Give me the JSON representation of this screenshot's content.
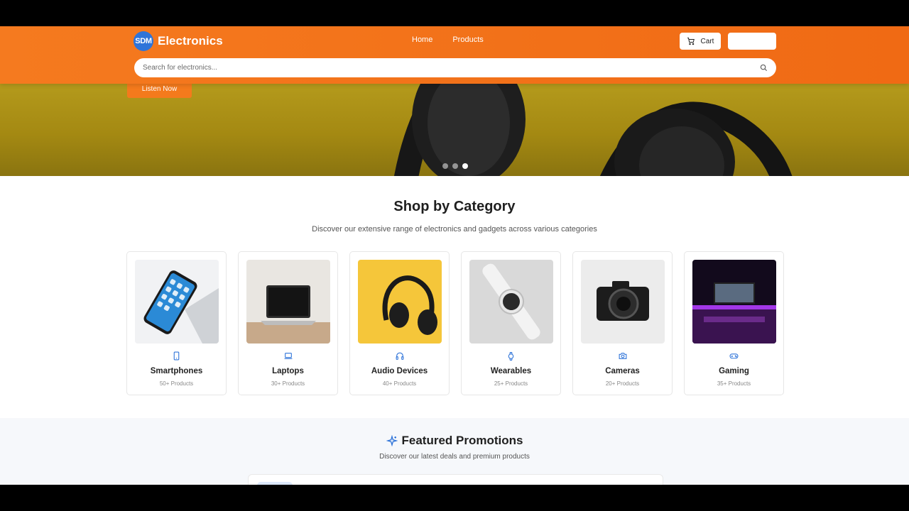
{
  "header": {
    "logo_badge": "SDM",
    "logo_text": "Electronics",
    "nav": [
      "Home",
      "Products"
    ],
    "cart_label": "Cart",
    "search_placeholder": "Search for electronics..."
  },
  "hero": {
    "cta_label": "Listen Now",
    "slides_total": 3,
    "active_slide": 3
  },
  "categories_section": {
    "title": "Shop by Category",
    "subtitle": "Discover our extensive range of electronics and gadgets across various categories",
    "items": [
      {
        "name": "Smartphones",
        "count": "50+ Products",
        "icon": "smartphone-icon"
      },
      {
        "name": "Laptops",
        "count": "30+ Products",
        "icon": "laptop-icon"
      },
      {
        "name": "Audio Devices",
        "count": "40+ Products",
        "icon": "headphones-icon"
      },
      {
        "name": "Wearables",
        "count": "25+ Products",
        "icon": "watch-icon"
      },
      {
        "name": "Cameras",
        "count": "20+ Products",
        "icon": "camera-icon"
      },
      {
        "name": "Gaming",
        "count": "35+ Products",
        "icon": "gamepad-icon"
      }
    ]
  },
  "featured": {
    "title": "Featured Promotions",
    "subtitle": "Discover our latest deals and premium products"
  },
  "colors": {
    "header": "#f57a1f",
    "accent_blue": "#2f74d9",
    "hero_bg": "#a48912"
  }
}
